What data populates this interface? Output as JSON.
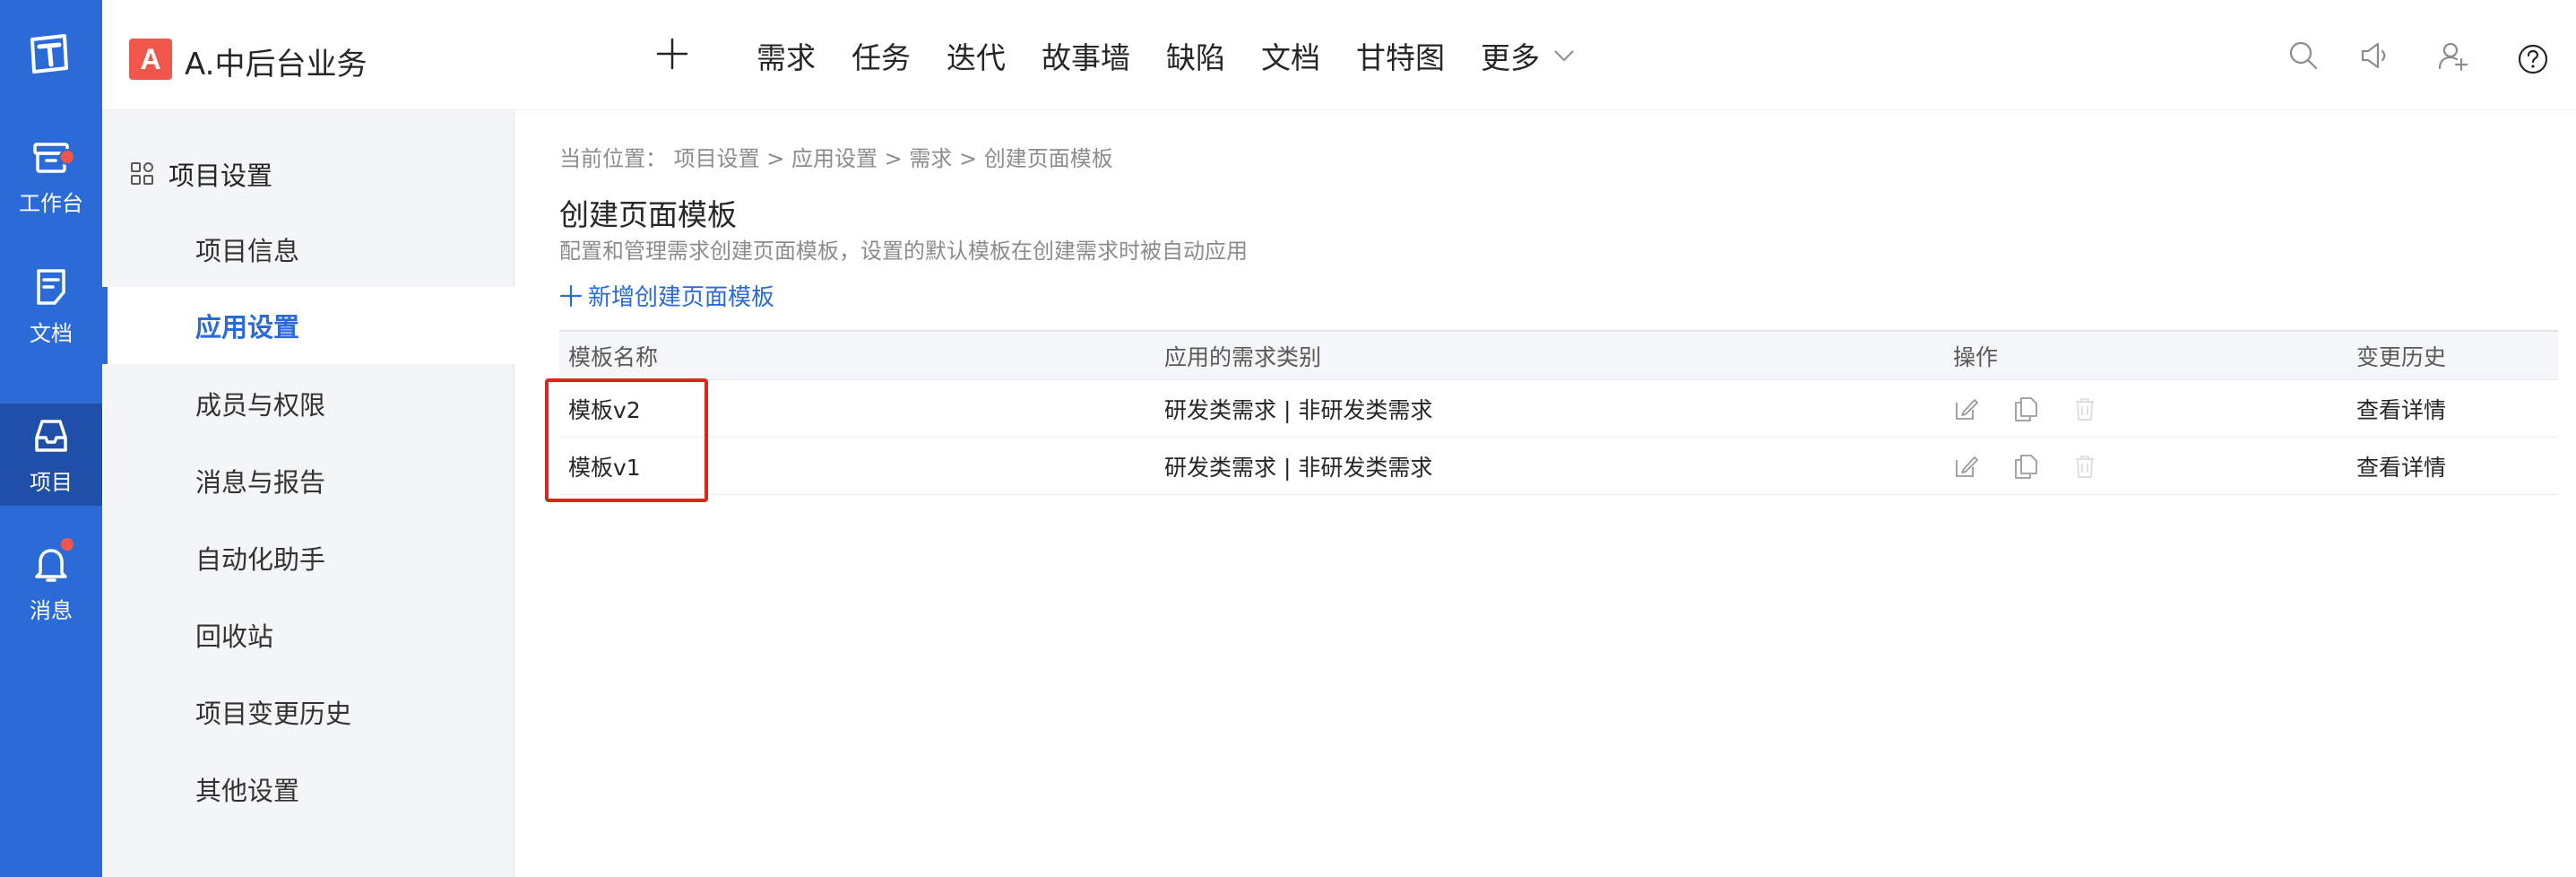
{
  "colors": {
    "rail_bg": "#2b6bd8",
    "rail_active_bg": "#1f4fa8",
    "accent": "#2b6bd8",
    "badge_red": "#f0564a",
    "highlight_red": "#e2231a"
  },
  "rail": {
    "logo_icon": "tapd-logo-icon",
    "items": [
      {
        "label": "工作台",
        "icon": "workbench-icon",
        "has_dot": true
      },
      {
        "label": "文档",
        "icon": "document-icon",
        "has_dot": false
      },
      {
        "label": "项目",
        "icon": "project-inbox-icon",
        "has_dot": false,
        "active": true
      },
      {
        "label": "消息",
        "icon": "bell-icon",
        "has_dot": true
      }
    ]
  },
  "header": {
    "project_badge": "A",
    "project_name": "A.中后台业务",
    "nav": [
      "需求",
      "任务",
      "迭代",
      "故事墙",
      "缺陷",
      "文档",
      "甘特图"
    ],
    "more_label": "更多",
    "icons": [
      "search-icon",
      "announcement-icon",
      "invite-user-icon",
      "help-icon"
    ]
  },
  "sidebar": {
    "title": "项目设置",
    "items": [
      {
        "label": "项目信息"
      },
      {
        "label": "应用设置",
        "active": true
      },
      {
        "label": "成员与权限"
      },
      {
        "label": "消息与报告"
      },
      {
        "label": "自动化助手"
      },
      {
        "label": "回收站"
      },
      {
        "label": "项目变更历史"
      },
      {
        "label": "其他设置"
      }
    ]
  },
  "main": {
    "breadcrumb": "当前位置： 项目设置 > 应用设置 > 需求 > 创建页面模板",
    "title": "创建页面模板",
    "description": "配置和管理需求创建页面模板，设置的默认模板在创建需求时被自动应用",
    "add_label": "新增创建页面模板",
    "table": {
      "headers": [
        "模板名称",
        "应用的需求类别",
        "操作",
        "变更历史"
      ],
      "rows": [
        {
          "name": "模板v2",
          "types": "研发类需求 | 非研发类需求",
          "history": "查看详情"
        },
        {
          "name": "模板v1",
          "types": "研发类需求 | 非研发类需求",
          "history": "查看详情"
        }
      ],
      "op_icons": [
        "edit-icon",
        "copy-icon",
        "delete-icon"
      ]
    }
  }
}
